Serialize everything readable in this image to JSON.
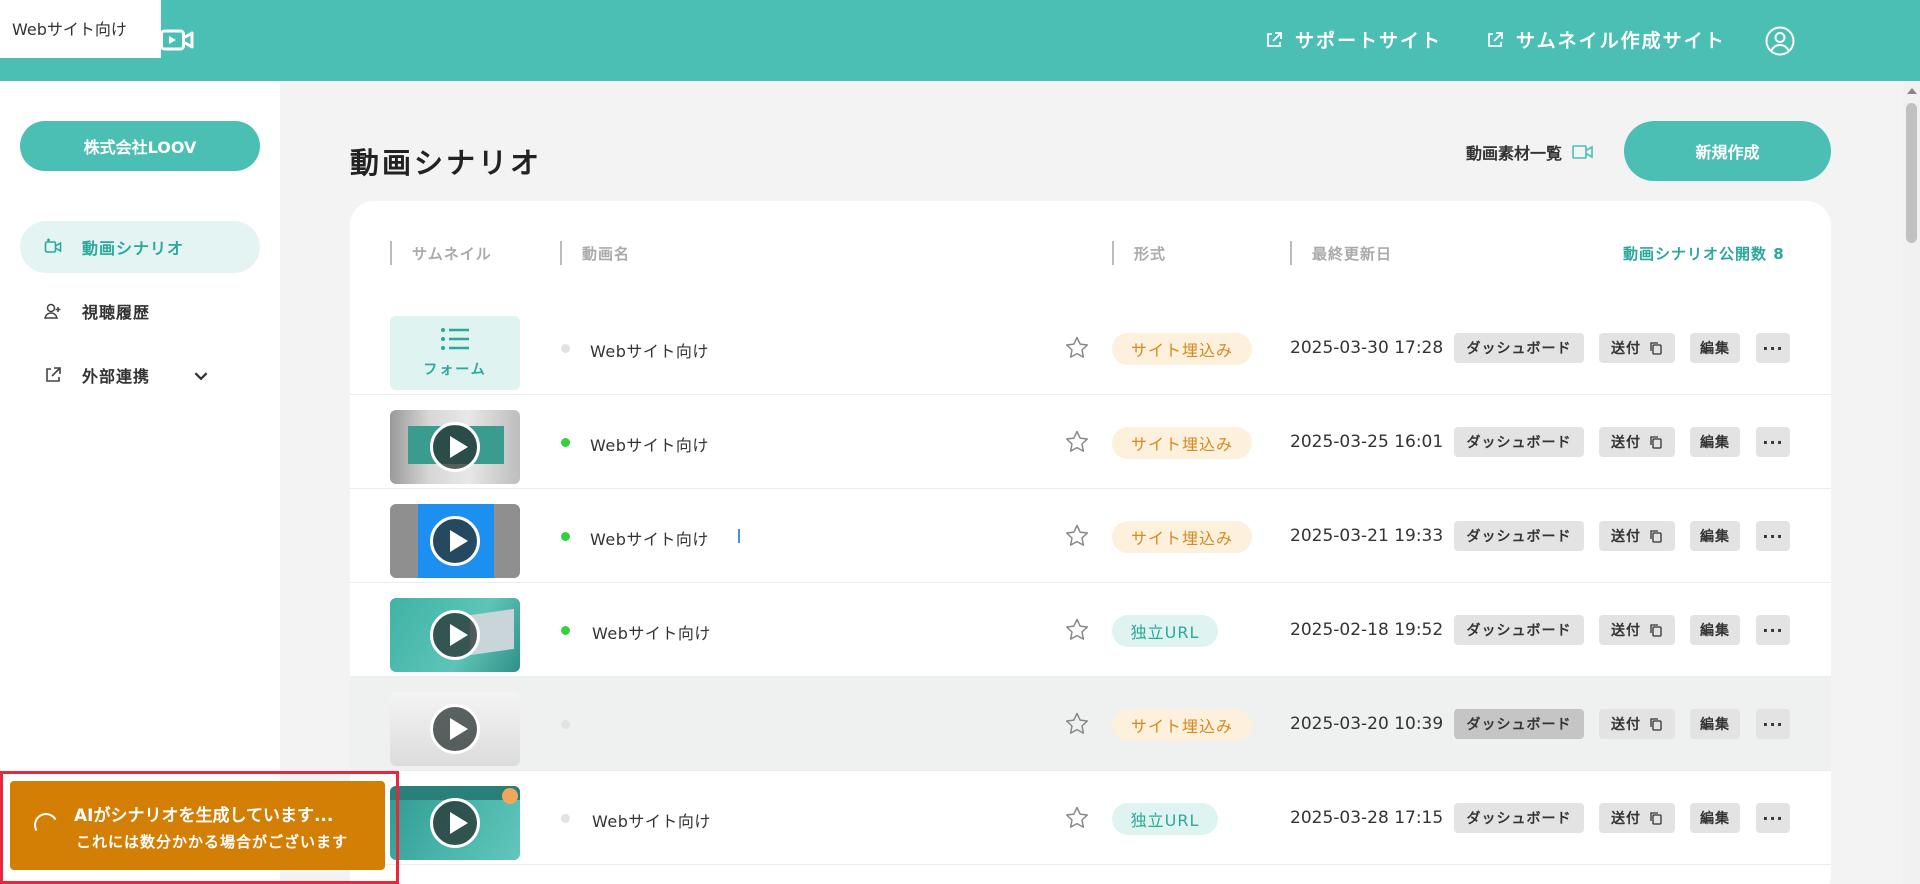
{
  "header": {
    "tooltip": "Webサイト向け",
    "support_site": "サポートサイト",
    "thumbnail_site": "サムネイル作成サイト"
  },
  "sidebar": {
    "company": "株式会社LOOV",
    "items": [
      {
        "label": "動画シナリオ",
        "icon": "video-plus-icon"
      },
      {
        "label": "視聴履歴",
        "icon": "user-plus-icon"
      },
      {
        "label": "外部連携",
        "icon": "external-link-icon"
      }
    ]
  },
  "main": {
    "title": "動画シナリオ",
    "materials_link": "動画素材一覧",
    "new_button": "新規作成",
    "columns": {
      "thumbnail": "サムネイル",
      "name": "動画名",
      "format": "形式",
      "updated": "最終更新日",
      "public_count": "動画シナリオ公開数 8"
    },
    "rows": [
      {
        "thumb_label": "フォーム",
        "status_active": false,
        "name": "Webサイト向け",
        "format": "サイト埋込み",
        "date": "2025-03-30 17:28"
      },
      {
        "thumb_label": "",
        "status_active": true,
        "name": "Webサイト向け",
        "format": "サイト埋込み",
        "date": "2025-03-25 16:01"
      },
      {
        "thumb_label": "",
        "status_active": true,
        "name": "Webサイト向け",
        "format": "サイト埋込み",
        "date": "2025-03-21 19:33"
      },
      {
        "thumb_label": "",
        "status_active": true,
        "name": "Webサイト向け",
        "format": "独立URL",
        "date": "2025-02-18 19:52"
      },
      {
        "thumb_label": "",
        "status_active": false,
        "name": "",
        "format": "サイト埋込み",
        "date": "2025-03-20 10:39"
      },
      {
        "thumb_label": "",
        "status_active": false,
        "name": "Webサイト向け",
        "format": "独立URL",
        "date": "2025-03-28 17:15"
      }
    ],
    "actions": {
      "dashboard": "ダッシュボード",
      "send": "送付",
      "edit": "編集",
      "more": "···"
    }
  },
  "toast": {
    "title": "AIがシナリオを生成しています...",
    "subtitle": "これには数分かかる場合がございます"
  },
  "colors": {
    "accent": "#4bbfb3",
    "accent_dark": "#2ba89c",
    "toast": "#d37f05",
    "site_badge_bg": "#fdf0dc",
    "site_badge_text": "#d8891d",
    "active_dot": "#35d13a"
  }
}
